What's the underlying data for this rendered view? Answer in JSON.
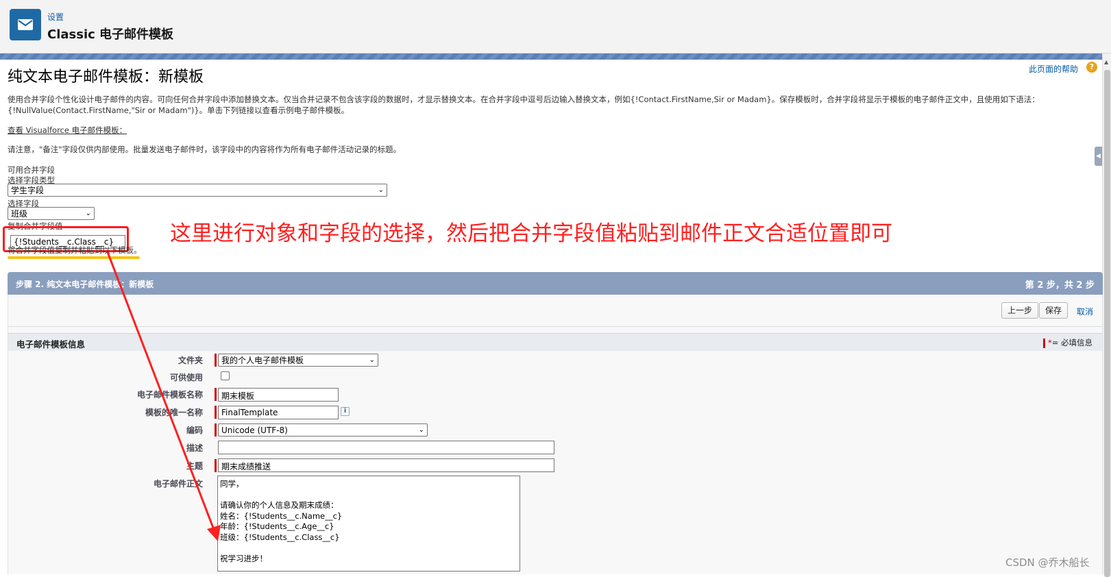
{
  "header": {
    "breadcrumb": "设置",
    "title": "Classic 电子邮件模板",
    "icon": "envelope-icon"
  },
  "page": {
    "title": "纯文本电子邮件模板：新模板",
    "help_link": "此页面的帮助",
    "intro_line1": "使用合并字段个性化设计电子邮件的内容。可向任何合并字段中添加替换文本。仅当合并记录不包含该字段的数据时，才显示替换文本。在合并字段中逗号后边输入替换文本，例如{!Contact.FirstName,Sir or Madam}。保存模板时，合并字段将显示于模板的电子邮件正文中，且使用如下语法：",
    "intro_line2": "{!NullValue(Contact.FirstName,\"Sir or Madam\")}。单击下列链接以查看示例电子邮件模板。",
    "vf_link": "查看 Visualforce 电子邮件模板：",
    "note": "请注意，\"备注\"字段仅供内部使用。批量发送电子邮件时，该字段中的内容将作为所有电子邮件活动记录的标题。"
  },
  "merge": {
    "heading": "可用合并字段",
    "type_label": "选择字段类型",
    "type_value": "学生字段",
    "field_label": "选择字段",
    "field_value": "班级",
    "copy_label": "复制合并字段值",
    "copy_value": "{!Students__c.Class__c}",
    "copy_hint": "将合并字段值复制并粘贴到以下模板。"
  },
  "annotation": "这里进行对象和字段的选择，然后把合并字段值粘贴到邮件正文合适位置即可",
  "step": {
    "title": "步骤 2. 纯文本电子邮件模板：新模板",
    "progress": "第 2 步，共 2 步",
    "prev_button": "上一步",
    "save_button": "保存",
    "cancel_link": "取消"
  },
  "section": {
    "title": "电子邮件模板信息",
    "required_legend": "= 必填信息"
  },
  "form": {
    "folder_label": "文件夹",
    "folder_value": "我的个人电子邮件模板",
    "available_label": "可供使用",
    "available_checked": false,
    "name_label": "电子邮件模板名称",
    "name_value": "期末模板",
    "unique_label": "模板的唯一名称",
    "unique_value": "FinalTemplate",
    "encoding_label": "编码",
    "encoding_value": "Unicode (UTF-8)",
    "desc_label": "描述",
    "desc_value": "",
    "subject_label": "主题",
    "subject_value": "期末成绩推送",
    "body_label": "电子邮件正文",
    "body_value": "同学，\n\n请确认你的个人信息及期末成绩：\n姓名：{!Students__c.Name__c}\n年龄：{!Students__c.Age__c}\n班级：{!Students__c.Class__c}\n\n祝学习进步！"
  },
  "watermark": "CSDN @乔木船长",
  "colors": {
    "accent_blue": "#1f6aa5",
    "step_bar": "#8a9ebe",
    "annotation_red": "#ff2020",
    "required_red": "#cc0000",
    "highlight_yellow": "#f5c518"
  }
}
